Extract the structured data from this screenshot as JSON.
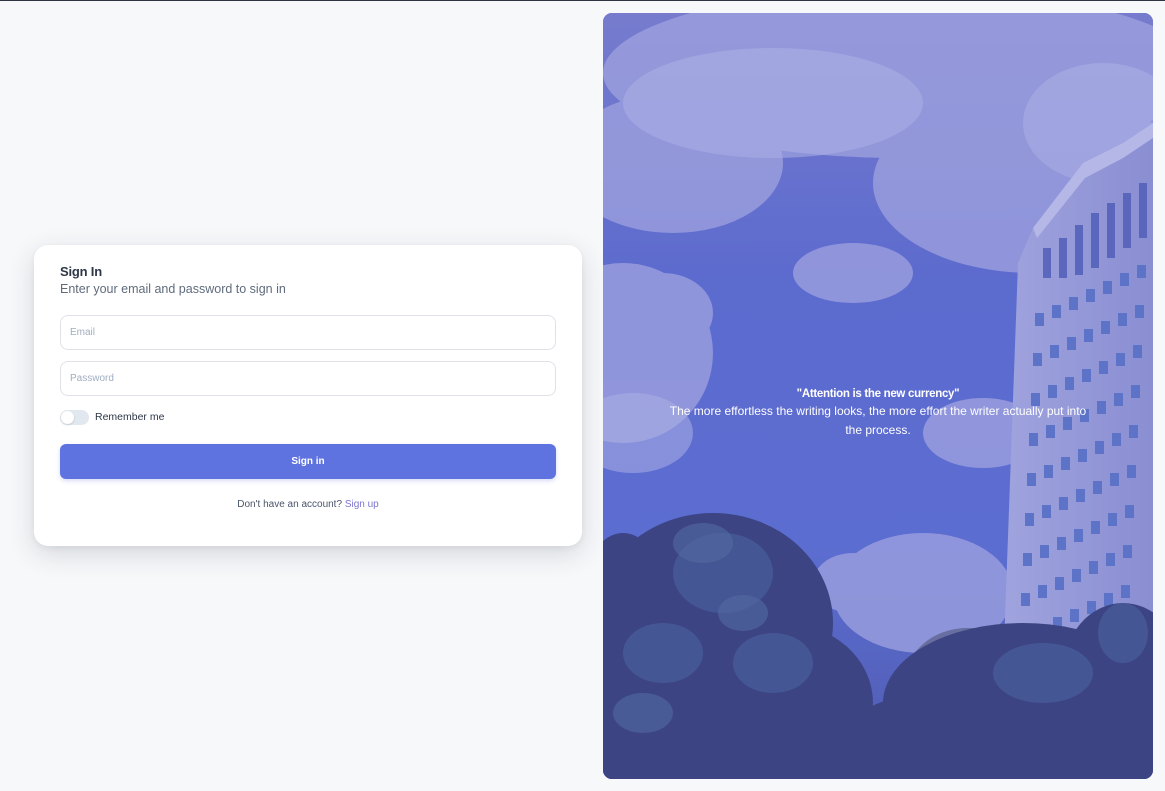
{
  "signin": {
    "title": "Sign In",
    "subtitle": "Enter your email and password to sign in",
    "email_placeholder": "Email",
    "password_placeholder": "Password",
    "remember_label": "Remember me",
    "remember_checked": false,
    "submit_label": "Sign in",
    "signup_prompt": "Don't have an account?",
    "signup_link": "Sign up"
  },
  "hero": {
    "quote_title": "\"Attention is the new currency\"",
    "quote_text": "The more effortless the writing looks, the more effort the writer actually put into the process."
  },
  "colors": {
    "accent": "#5f73e0",
    "link": "#7a74d0",
    "page_bg": "#f7f8fa",
    "overlay": "#6260c8"
  }
}
